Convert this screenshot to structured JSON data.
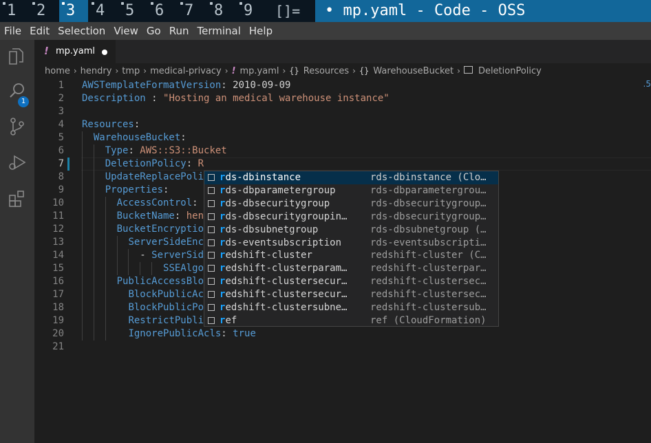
{
  "workspaces": [
    {
      "label": "1",
      "active": false
    },
    {
      "label": "2",
      "active": false
    },
    {
      "label": "3",
      "active": true
    },
    {
      "label": "4",
      "active": false
    },
    {
      "label": "5",
      "active": false
    },
    {
      "label": "6",
      "active": false
    },
    {
      "label": "7",
      "active": false
    },
    {
      "label": "8",
      "active": false
    },
    {
      "label": "9",
      "active": false
    }
  ],
  "layout_indicator": "[]=",
  "window_title": "• mp.yaml - Code - OSS",
  "menu": [
    "File",
    "Edit",
    "Selection",
    "View",
    "Go",
    "Run",
    "Terminal",
    "Help"
  ],
  "activity": {
    "items": [
      "explorer-icon",
      "search-icon",
      "source-control-icon",
      "run-debug-icon",
      "extensions-icon"
    ],
    "explorer_badge": "1"
  },
  "tab": {
    "icon": "!",
    "label": "mp.yaml",
    "dirty": true
  },
  "breadcrumb": [
    {
      "text": "home",
      "icon": ""
    },
    {
      "text": "hendry",
      "icon": ""
    },
    {
      "text": "tmp",
      "icon": ""
    },
    {
      "text": "medical-privacy",
      "icon": ""
    },
    {
      "text": "mp.yaml",
      "icon": "!"
    },
    {
      "text": "Resources",
      "icon": "{}"
    },
    {
      "text": "WarehouseBucket",
      "icon": "{}"
    },
    {
      "text": "DeletionPolicy",
      "icon": "box"
    }
  ],
  "editor": {
    "current_line": 7,
    "lines": [
      {
        "n": "1",
        "parts": [
          [
            "k",
            "AWSTemplateFormatVersion"
          ],
          [
            "p",
            ": "
          ],
          [
            "p",
            "2010-09-09"
          ]
        ]
      },
      {
        "n": "2",
        "parts": [
          [
            "k",
            "Description"
          ],
          [
            "p",
            " : "
          ],
          [
            "s",
            "\"Hosting an medical warehouse instance\""
          ]
        ]
      },
      {
        "n": "3",
        "parts": []
      },
      {
        "n": "4",
        "parts": [
          [
            "k",
            "Resources"
          ],
          [
            "p",
            ":"
          ]
        ]
      },
      {
        "n": "5",
        "parts": [
          [
            "p",
            "  "
          ],
          [
            "k",
            "WarehouseBucket"
          ],
          [
            "p",
            ":"
          ]
        ]
      },
      {
        "n": "6",
        "parts": [
          [
            "p",
            "    "
          ],
          [
            "k",
            "Type"
          ],
          [
            "p",
            ": "
          ],
          [
            "s",
            "AWS::S3::Bucket"
          ]
        ]
      },
      {
        "n": "7",
        "parts": [
          [
            "p",
            "    "
          ],
          [
            "k",
            "DeletionPolicy"
          ],
          [
            "p",
            ": "
          ],
          [
            "s",
            "R"
          ]
        ]
      },
      {
        "n": "8",
        "parts": [
          [
            "p",
            "    "
          ],
          [
            "k",
            "UpdateReplacePoli"
          ]
        ]
      },
      {
        "n": "9",
        "parts": [
          [
            "p",
            "    "
          ],
          [
            "k",
            "Properties"
          ],
          [
            "p",
            ":"
          ]
        ]
      },
      {
        "n": "10",
        "parts": [
          [
            "p",
            "      "
          ],
          [
            "k",
            "AccessControl"
          ],
          [
            "p",
            ":"
          ]
        ]
      },
      {
        "n": "11",
        "parts": [
          [
            "p",
            "      "
          ],
          [
            "k",
            "BucketName"
          ],
          [
            "p",
            ": "
          ],
          [
            "s",
            "hen"
          ]
        ]
      },
      {
        "n": "12",
        "parts": [
          [
            "p",
            "      "
          ],
          [
            "k",
            "BucketEncryptio"
          ]
        ]
      },
      {
        "n": "13",
        "parts": [
          [
            "p",
            "        "
          ],
          [
            "k",
            "ServerSideEnc"
          ]
        ]
      },
      {
        "n": "14",
        "parts": [
          [
            "p",
            "          "
          ],
          [
            "p",
            "- "
          ],
          [
            "k",
            "ServerSid"
          ]
        ]
      },
      {
        "n": "15",
        "parts": [
          [
            "p",
            "              "
          ],
          [
            "k",
            "SSEAlgo"
          ]
        ]
      },
      {
        "n": "16",
        "parts": [
          [
            "p",
            "      "
          ],
          [
            "k",
            "PublicAccessBlo"
          ]
        ]
      },
      {
        "n": "17",
        "parts": [
          [
            "p",
            "        "
          ],
          [
            "k",
            "BlockPublicAc"
          ]
        ]
      },
      {
        "n": "18",
        "parts": [
          [
            "p",
            "        "
          ],
          [
            "k",
            "BlockPublicPo"
          ]
        ]
      },
      {
        "n": "19",
        "parts": [
          [
            "p",
            "        "
          ],
          [
            "k",
            "RestrictPubli"
          ]
        ]
      },
      {
        "n": "20",
        "parts": [
          [
            "p",
            "        "
          ],
          [
            "k",
            "IgnorePublicAcls"
          ],
          [
            "p",
            ": "
          ],
          [
            "k",
            "true"
          ]
        ]
      },
      {
        "n": "21",
        "parts": []
      }
    ]
  },
  "suggestions": [
    {
      "label": "rds-dbinstance",
      "match": "r",
      "detail": "rds-dbinstance (Clo…",
      "selected": true
    },
    {
      "label": "rds-dbparametergroup",
      "match": "r",
      "detail": "rds-dbparametergrou…",
      "selected": false
    },
    {
      "label": "rds-dbsecuritygroup",
      "match": "r",
      "detail": "rds-dbsecuritygroup…",
      "selected": false
    },
    {
      "label": "rds-dbsecuritygroupin…",
      "match": "r",
      "detail": "rds-dbsecuritygroup…",
      "selected": false
    },
    {
      "label": "rds-dbsubnetgroup",
      "match": "r",
      "detail": "rds-dbsubnetgroup (…",
      "selected": false
    },
    {
      "label": "rds-eventsubscription",
      "match": "r",
      "detail": "rds-eventsubscripti…",
      "selected": false
    },
    {
      "label": "redshift-cluster",
      "match": "r",
      "detail": "redshift-cluster (C…",
      "selected": false
    },
    {
      "label": "redshift-clusterparam…",
      "match": "r",
      "detail": "redshift-clusterpar…",
      "selected": false
    },
    {
      "label": "redshift-clustersecur…",
      "match": "r",
      "detail": "redshift-clustersec…",
      "selected": false
    },
    {
      "label": "redshift-clustersecur…",
      "match": "r",
      "detail": "redshift-clustersec…",
      "selected": false
    },
    {
      "label": "redshift-clustersubne…",
      "match": "r",
      "detail": "redshift-clustersub…",
      "selected": false
    },
    {
      "label": "ref",
      "match": "r",
      "detail": " ref (CloudFormation)",
      "selected": false
    }
  ],
  "overview_mark": ".5"
}
